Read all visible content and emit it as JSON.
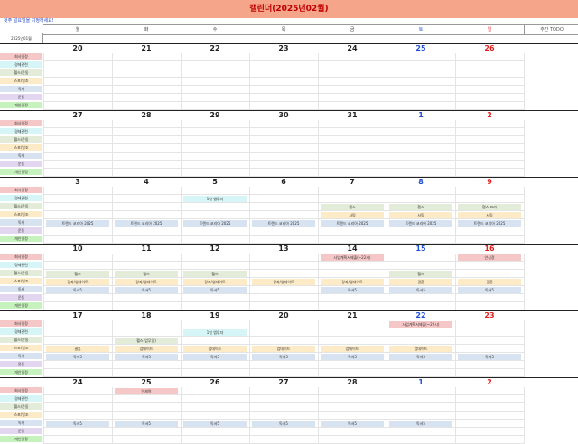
{
  "title": "캘린더(2025년02월)",
  "note": "첫주 일요일을 지정하세요!",
  "month_label": "2025년01월",
  "todo_label": "주간 TODO",
  "weekdays": [
    "월",
    "화",
    "수",
    "목",
    "금",
    "토",
    "일"
  ],
  "categories": [
    {
      "label": "회사일정",
      "color": "#f6c7c7"
    },
    {
      "label": "경제관련",
      "color": "#d6f5f7"
    },
    {
      "label": "헬스/운동",
      "color": "#e3ecd9"
    },
    {
      "label": "스포/일조",
      "color": "#fdebc7"
    },
    {
      "label": "독서",
      "color": "#d8e3f1"
    },
    {
      "label": "운동",
      "color": "#e2d6f0"
    },
    {
      "label": "개인일정",
      "color": "#c6f3bd"
    }
  ],
  "weeks": [
    {
      "days": [
        "20",
        "21",
        "22",
        "23",
        "24",
        "25",
        "26"
      ],
      "events": []
    },
    {
      "days": [
        "27",
        "28",
        "29",
        "30",
        "31",
        "1",
        "2"
      ],
      "events": []
    },
    {
      "days": [
        "3",
        "4",
        "5",
        "6",
        "7",
        "8",
        "9"
      ],
      "events": [
        {
          "day": 2,
          "row": 1,
          "text": "1일 앱투자",
          "color": "#d6f5f7"
        },
        {
          "day": 4,
          "row": 2,
          "text": "헬스",
          "color": "#e3ecd9"
        },
        {
          "day": 5,
          "row": 2,
          "text": "헬스",
          "color": "#e3ecd9"
        },
        {
          "day": 6,
          "row": 2,
          "text": "헬스 프라",
          "color": "#e3ecd9"
        },
        {
          "day": 4,
          "row": 3,
          "text": "서핑",
          "color": "#fdebc7"
        },
        {
          "day": 5,
          "row": 3,
          "text": "서핑",
          "color": "#fdebc7"
        },
        {
          "day": 6,
          "row": 3,
          "text": "서핑",
          "color": "#fdebc7"
        },
        {
          "day": 0,
          "row": 4,
          "text": "트렌드 코리아 2025",
          "color": "#d8e3f1"
        },
        {
          "day": 1,
          "row": 4,
          "text": "트렌드 코리아 2025",
          "color": "#d8e3f1"
        },
        {
          "day": 2,
          "row": 4,
          "text": "트렌드 코리아 2025",
          "color": "#d8e3f1"
        },
        {
          "day": 3,
          "row": 4,
          "text": "트렌드 코리아 2025",
          "color": "#d8e3f1"
        },
        {
          "day": 4,
          "row": 4,
          "text": "트렌드 코리아 2025",
          "color": "#d8e3f1"
        },
        {
          "day": 5,
          "row": 4,
          "text": "트렌드 코리아 2025",
          "color": "#d8e3f1"
        },
        {
          "day": 6,
          "row": 4,
          "text": "트렌드 코리아 2025",
          "color": "#d8e3f1"
        }
      ]
    },
    {
      "days": [
        "10",
        "11",
        "12",
        "13",
        "14",
        "15",
        "16"
      ],
      "events": [
        {
          "day": 4,
          "row": 0,
          "text": "사업계획서제출(~22시)",
          "color": "#f6c7c7"
        },
        {
          "day": 6,
          "row": 0,
          "text": "안심정",
          "color": "#f6c7c7"
        },
        {
          "day": 0,
          "row": 2,
          "text": "헬스",
          "color": "#e3ecd9"
        },
        {
          "day": 1,
          "row": 2,
          "text": "헬스",
          "color": "#e3ecd9"
        },
        {
          "day": 2,
          "row": 2,
          "text": "헬스",
          "color": "#e3ecd9"
        },
        {
          "day": 5,
          "row": 2,
          "text": "헬스",
          "color": "#e3ecd9"
        },
        {
          "day": 0,
          "row": 3,
          "text": "강좌/업데이트",
          "color": "#fdebc7"
        },
        {
          "day": 1,
          "row": 3,
          "text": "강좌/업데이트",
          "color": "#fdebc7"
        },
        {
          "day": 2,
          "row": 3,
          "text": "강좌/업데이트",
          "color": "#fdebc7"
        },
        {
          "day": 3,
          "row": 3,
          "text": "강좌/업데이트",
          "color": "#fdebc7"
        },
        {
          "day": 4,
          "row": 3,
          "text": "강좌/업데이트",
          "color": "#fdebc7"
        },
        {
          "day": 5,
          "row": 3,
          "text": "결혼",
          "color": "#fdebc7"
        },
        {
          "day": 6,
          "row": 3,
          "text": "결혼",
          "color": "#fdebc7"
        },
        {
          "day": 0,
          "row": 4,
          "text": "독서5",
          "color": "#d8e3f1"
        },
        {
          "day": 1,
          "row": 4,
          "text": "독서5",
          "color": "#d8e3f1"
        },
        {
          "day": 2,
          "row": 4,
          "text": "독서5",
          "color": "#d8e3f1"
        },
        {
          "day": 4,
          "row": 4,
          "text": "독서5",
          "color": "#d8e3f1"
        },
        {
          "day": 5,
          "row": 4,
          "text": "독서5",
          "color": "#d8e3f1"
        },
        {
          "day": 6,
          "row": 4,
          "text": "독서5",
          "color": "#d8e3f1"
        }
      ]
    },
    {
      "days": [
        "17",
        "18",
        "19",
        "20",
        "21",
        "22",
        "23"
      ],
      "events": [
        {
          "day": 5,
          "row": 0,
          "text": "사업계획서제출(~22시)",
          "color": "#f6c7c7"
        },
        {
          "day": 2,
          "row": 1,
          "text": "1일 앱투자",
          "color": "#d6f5f7"
        },
        {
          "day": 1,
          "row": 2,
          "text": "헬스(업무일)",
          "color": "#e3ecd9"
        },
        {
          "day": 0,
          "row": 3,
          "text": "결혼",
          "color": "#fdebc7"
        },
        {
          "day": 1,
          "row": 3,
          "text": "업데이트",
          "color": "#fdebc7"
        },
        {
          "day": 2,
          "row": 3,
          "text": "업데이트",
          "color": "#fdebc7"
        },
        {
          "day": 3,
          "row": 3,
          "text": "업데이트",
          "color": "#fdebc7"
        },
        {
          "day": 4,
          "row": 3,
          "text": "업데이트",
          "color": "#fdebc7"
        },
        {
          "day": 5,
          "row": 3,
          "text": "업데이트",
          "color": "#fdebc7"
        },
        {
          "day": 0,
          "row": 4,
          "text": "독서5",
          "color": "#d8e3f1"
        },
        {
          "day": 1,
          "row": 4,
          "text": "독서5",
          "color": "#d8e3f1"
        },
        {
          "day": 2,
          "row": 4,
          "text": "독서5",
          "color": "#d8e3f1"
        },
        {
          "day": 3,
          "row": 4,
          "text": "독서5",
          "color": "#d8e3f1"
        },
        {
          "day": 4,
          "row": 4,
          "text": "독서5",
          "color": "#d8e3f1"
        },
        {
          "day": 5,
          "row": 4,
          "text": "독서5",
          "color": "#d8e3f1"
        },
        {
          "day": 6,
          "row": 4,
          "text": "독서5",
          "color": "#d8e3f1"
        }
      ]
    },
    {
      "days": [
        "24",
        "25",
        "26",
        "27",
        "28",
        "1",
        "2"
      ],
      "events": [
        {
          "day": 1,
          "row": 0,
          "text": "인재원",
          "color": "#f6c7c7"
        },
        {
          "day": 0,
          "row": 4,
          "text": "독서5",
          "color": "#d8e3f1"
        },
        {
          "day": 1,
          "row": 4,
          "text": "독서5",
          "color": "#d8e3f1"
        },
        {
          "day": 2,
          "row": 4,
          "text": "독서5",
          "color": "#d8e3f1"
        },
        {
          "day": 3,
          "row": 4,
          "text": "독서5",
          "color": "#d8e3f1"
        },
        {
          "day": 4,
          "row": 4,
          "text": "독서5",
          "color": "#d8e3f1"
        },
        {
          "day": 5,
          "row": 4,
          "text": "독서5",
          "color": "#d8e3f1"
        }
      ]
    }
  ]
}
